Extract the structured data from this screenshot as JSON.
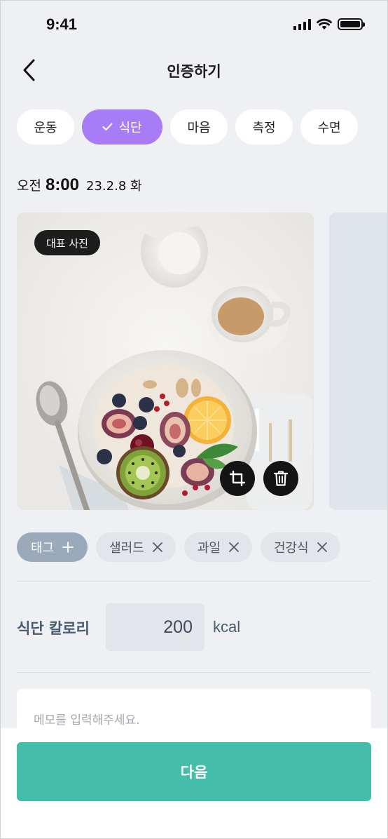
{
  "status_bar": {
    "time": "9:41",
    "icons": [
      "cellular-signal-icon",
      "wifi-icon",
      "battery-icon"
    ]
  },
  "header": {
    "back_icon": "chevron-left-icon",
    "title": "인증하기"
  },
  "tabs": [
    {
      "label": "운동",
      "active": false
    },
    {
      "label": "식단",
      "active": true,
      "icon": "check-icon"
    },
    {
      "label": "마음",
      "active": false
    },
    {
      "label": "측정",
      "active": false
    },
    {
      "label": "수면",
      "active": false
    }
  ],
  "datetime": {
    "ampm": "오전",
    "time": "8:00",
    "date": "23.2.8 화"
  },
  "photo": {
    "badge": "대표 사진",
    "subject": "fruit bowl with figs, kiwi, orange, blueberries, coffee and milk jug",
    "buttons": [
      "crop-icon",
      "trash-icon"
    ]
  },
  "tags": {
    "add_label": "태그",
    "add_icon": "plus-icon",
    "items": [
      "샐러드",
      "과일",
      "건강식"
    ],
    "remove_icon": "close-icon"
  },
  "calories": {
    "label": "식단 칼로리",
    "value": "200",
    "unit": "kcal"
  },
  "memo": {
    "placeholder": "메모를 입력해주세요."
  },
  "footer": {
    "next_label": "다음"
  },
  "colors": {
    "background": "#eef0f3",
    "accent_purple": "#a77cf6",
    "primary_teal": "#44beab",
    "tag_add": "#9aaabb",
    "chip_bg": "#e2e5ea"
  }
}
